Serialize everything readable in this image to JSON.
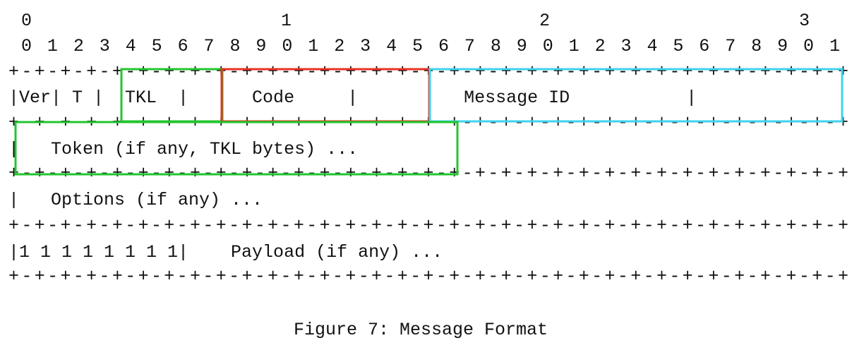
{
  "bit_ruler": {
    "tens": [
      "0",
      "1",
      "2",
      "3"
    ],
    "units": "0 1 2 3 4 5 6 7 8 9 0 1 2 3 4 5 6 7 8 9 0 1 2 3 4 5 6 7 8 9 0 1"
  },
  "separator": "+-+-+-+-+-+-+-+-+-+-+-+-+-+-+-+-+-+-+-+-+-+-+-+-+-+-+-+-+-+-+-+-+",
  "rows": {
    "header": "|Ver| T |  TKL  |      Code     |          Message ID           |",
    "token": "|   Token (if any, TKL bytes) ...",
    "options": "|   Options (if any) ...",
    "payload": "|1 1 1 1 1 1 1 1|    Payload (if any) ..."
  },
  "highlight_colors": {
    "tkl": "#22c52e",
    "code": "#e63322",
    "message_id": "#3fd2ee",
    "token": "#22c52e"
  },
  "caption": "Figure 7: Message Format"
}
